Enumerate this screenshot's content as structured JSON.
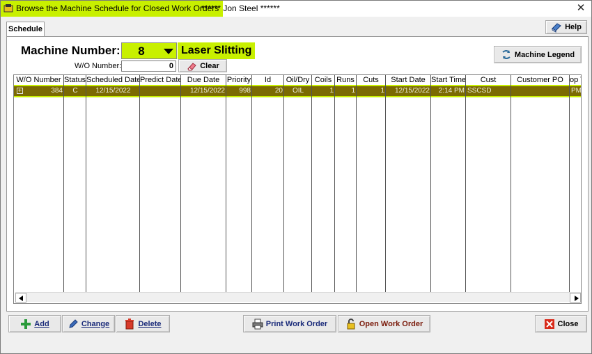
{
  "window": {
    "title": "Browse the Machine Schedule for Closed Work Orders",
    "user": "****** Jon Steel ******"
  },
  "tabs": [
    {
      "label": "Schedule",
      "active": true
    }
  ],
  "help_button": {
    "label": "Help",
    "icon": "book-icon"
  },
  "machine": {
    "label": "Machine Number:",
    "number": "8",
    "name": "Laser Slitting",
    "highlight_color": "#c8f000"
  },
  "wo_filter": {
    "label": "W/O Number:",
    "value": "0",
    "clear_label": "Clear"
  },
  "legend_button": {
    "label": "Machine Legend"
  },
  "grid": {
    "columns": [
      "W/O Number",
      "Status",
      "Scheduled Date",
      "Predict Date",
      "Due Date",
      "Priority",
      "Id",
      "Oil/Dry",
      "Coils",
      "Runs",
      "Cuts",
      "Start Date",
      "Start Time",
      "Cust",
      "Customer PO",
      "op T"
    ],
    "rows": [
      {
        "cells": [
          "384",
          "C",
          "12/15/2022",
          "",
          "12/15/2022",
          "998",
          "20",
          "OIL",
          "1",
          "1",
          "1",
          "12/15/2022",
          "2:14 PM",
          "SSCSD",
          "",
          "PM"
        ],
        "selected": true,
        "row_color": "#7b6a02"
      }
    ]
  },
  "bottom_buttons": {
    "add": "Add",
    "change": "Change",
    "delete": "Delete",
    "print": "Print Work Order",
    "open": "Open Work Order",
    "close": "Close"
  }
}
